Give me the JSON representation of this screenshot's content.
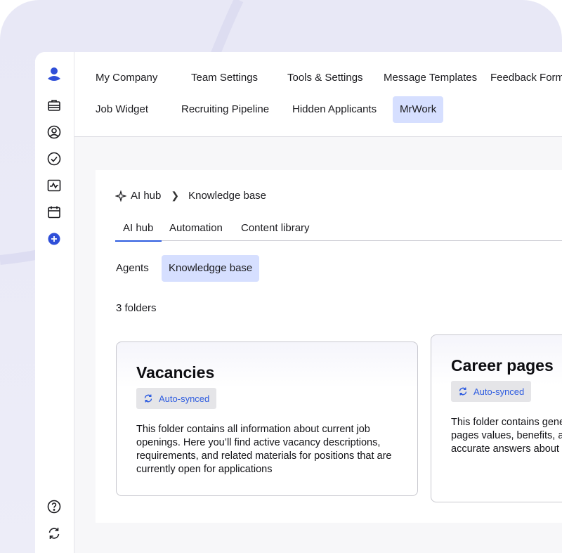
{
  "colors": {
    "accent": "#2f5de0",
    "active_tab_bg": "#d6dfff",
    "badge_bg": "#e5e5e8"
  },
  "sidebar": {
    "icons": [
      "logo-icon",
      "briefcase-icon",
      "profile-icon",
      "check-circle-icon",
      "activity-icon",
      "calendar-icon",
      "add-circle-icon",
      "help-icon",
      "sync-icon"
    ]
  },
  "topnav": {
    "row1": [
      "My Company",
      "Team Settings",
      "Tools & Settings",
      "Message Templates",
      "Feedback Form"
    ],
    "row2": [
      "Job Widget",
      "Recruiting Pipeline",
      "Hidden Applicants",
      "MrWork"
    ],
    "active": "MrWork"
  },
  "breadcrumb": {
    "root": "AI hub",
    "current": "Knowledge base"
  },
  "subtabs": [
    "AI hub",
    "Automation",
    "Content library"
  ],
  "subtabs_active": "AI hub",
  "pills": [
    "Agents",
    "Knowledgge base"
  ],
  "pills_active": "Knowledgge base",
  "folder_count": "3 folders",
  "cards": [
    {
      "title": "Vacancies",
      "badge": "Auto-synced",
      "description": "This folder contains all information about current job openings. Here you’ll find active vacancy descriptions, requirements, and related materials for positions that are currently open for applications"
    },
    {
      "title": "Career pages",
      "badge": "Auto-synced",
      "description": "This folder contains general information from your career pages values, benefits, and other uses this information to accurate answers about"
    }
  ]
}
